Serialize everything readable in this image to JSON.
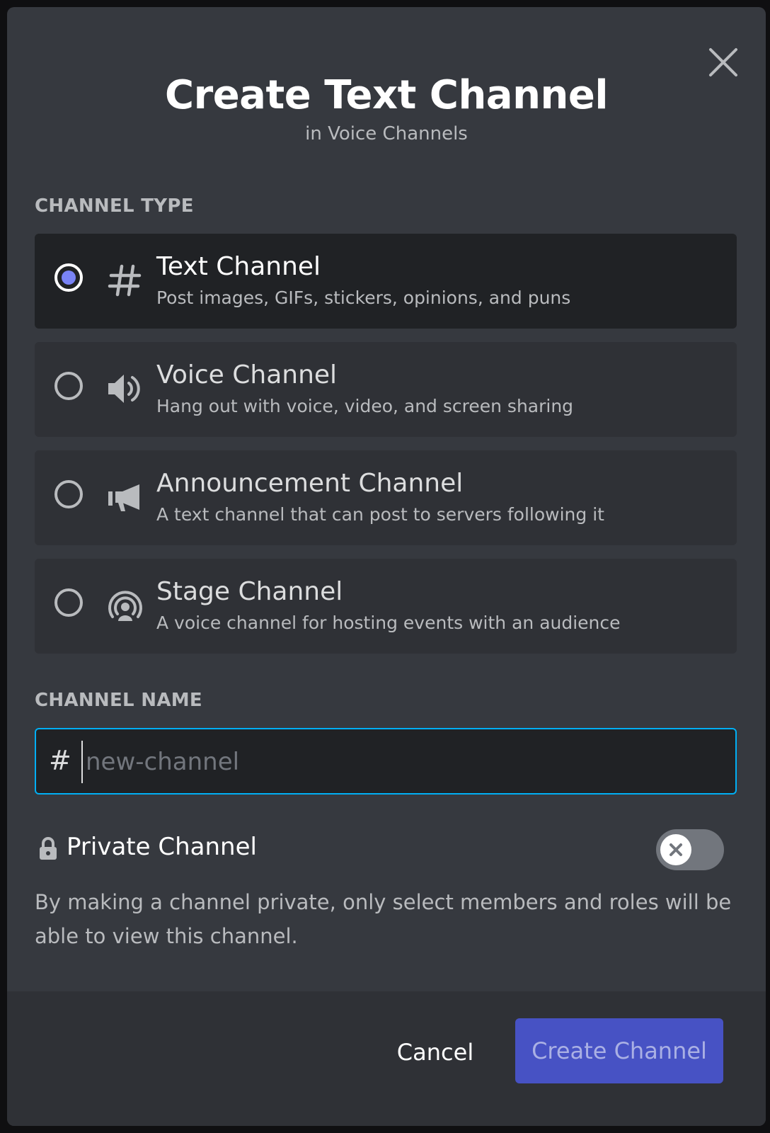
{
  "modal": {
    "title": "Create Text Channel",
    "subtitle": "in Voice Channels",
    "close_icon": "close-icon"
  },
  "channel_type": {
    "label": "CHANNEL TYPE",
    "selected": "text",
    "options": [
      {
        "id": "text",
        "icon": "hash-icon",
        "name": "Text Channel",
        "description": "Post images, GIFs, stickers, opinions, and puns",
        "selected": true
      },
      {
        "id": "voice",
        "icon": "speaker-icon",
        "name": "Voice Channel",
        "description": "Hang out with voice, video, and screen sharing",
        "selected": false
      },
      {
        "id": "announcement",
        "icon": "megaphone-icon",
        "name": "Announcement Channel",
        "description": "A text channel that can post to servers following it",
        "selected": false
      },
      {
        "id": "stage",
        "icon": "stage-icon",
        "name": "Stage Channel",
        "description": "A voice channel for hosting events with an audience",
        "selected": false
      }
    ]
  },
  "channel_name": {
    "label": "CHANNEL NAME",
    "prefix": "#",
    "value": "",
    "placeholder": "new-channel"
  },
  "private": {
    "label": "Private Channel",
    "enabled": false,
    "note": "By making a channel private, only select members and roles will be able to view this channel."
  },
  "footer": {
    "cancel_label": "Cancel",
    "create_label": "Create Channel"
  },
  "colors": {
    "modal_bg": "#36393f",
    "option_bg": "#2f3136",
    "selected_bg": "#202225",
    "accent": "#7983f5",
    "input_border": "#00aff4",
    "create_button": "#4752c4"
  }
}
